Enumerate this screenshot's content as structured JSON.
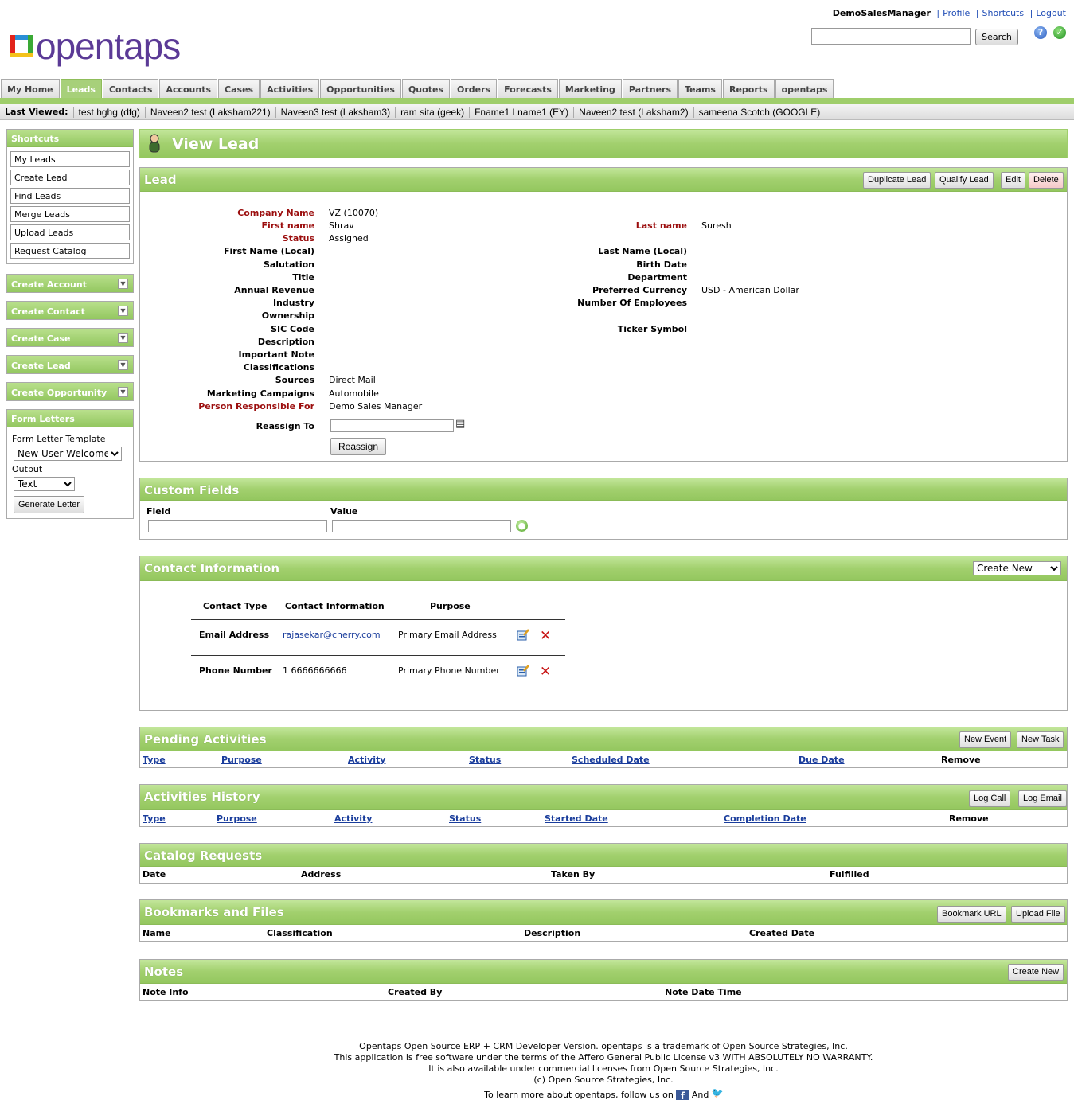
{
  "header": {
    "username": "DemoSalesManager",
    "links": [
      "Profile",
      "Shortcuts",
      "Logout"
    ],
    "logo_text": "opentaps",
    "search_button": "Search"
  },
  "tabs": [
    "My Home",
    "Leads",
    "Contacts",
    "Accounts",
    "Cases",
    "Activities",
    "Opportunities",
    "Quotes",
    "Orders",
    "Forecasts",
    "Marketing",
    "Partners",
    "Teams",
    "Reports",
    "opentaps"
  ],
  "active_tab": "Leads",
  "last_viewed": {
    "label": "Last Viewed:",
    "items": [
      "test hghg (dfg)",
      "Naveen2 test (Laksham221)",
      "Naveen3 test (Laksham3)",
      "ram sita (geek)",
      "Fname1 Lname1 (EY)",
      "Naveen2 test (Laksham2)",
      "sameena Scotch (GOOGLE)"
    ]
  },
  "sidebar": {
    "shortcuts_title": "Shortcuts",
    "shortcuts": [
      "My Leads",
      "Create Lead",
      "Find Leads",
      "Merge Leads",
      "Upload Leads",
      "Request Catalog"
    ],
    "create_sections": [
      "Create Account",
      "Create Contact",
      "Create Case",
      "Create Lead",
      "Create Opportunity"
    ],
    "form_letters": {
      "title": "Form Letters",
      "template_label": "Form Letter Template",
      "template_value": "New User Welcome",
      "output_label": "Output",
      "output_value": "Text",
      "generate_button": "Generate Letter"
    }
  },
  "page_title": "View Lead",
  "lead": {
    "title": "Lead",
    "buttons": [
      "Duplicate Lead",
      "Qualify Lead",
      "Edit",
      "Delete"
    ],
    "left_fields": [
      {
        "label": "Company Name",
        "value": "VZ (10070)",
        "required": true
      },
      {
        "label": "First name",
        "value": "Shrav",
        "required": true
      },
      {
        "label": "Status",
        "value": "Assigned",
        "required": true
      },
      {
        "label": "First Name (Local)",
        "value": "",
        "required": false
      },
      {
        "label": "Salutation",
        "value": "",
        "required": false
      },
      {
        "label": "Title",
        "value": "",
        "required": false
      },
      {
        "label": "Annual Revenue",
        "value": "",
        "required": false
      },
      {
        "label": "Industry",
        "value": "",
        "required": false
      },
      {
        "label": "Ownership",
        "value": "",
        "required": false
      },
      {
        "label": "SIC Code",
        "value": "",
        "required": false
      },
      {
        "label": "Description",
        "value": "",
        "required": false
      },
      {
        "label": "Important Note",
        "value": "",
        "required": false
      },
      {
        "label": "Classifications",
        "value": "",
        "required": false
      },
      {
        "label": "Sources",
        "value": "Direct Mail",
        "required": false
      },
      {
        "label": "Marketing Campaigns",
        "value": "Automobile",
        "required": false
      }
    ],
    "right_fields": [
      {
        "label": "Last name",
        "value": "Suresh",
        "required": true
      },
      {
        "label": "Last Name (Local)",
        "value": "",
        "required": false
      },
      {
        "label": "Birth Date",
        "value": "",
        "required": false
      },
      {
        "label": "Department",
        "value": "",
        "required": false
      },
      {
        "label": "Preferred Currency",
        "value": "USD - American Dollar",
        "required": false
      },
      {
        "label": "Number Of Employees",
        "value": "",
        "required": false
      },
      {
        "label": "Ticker Symbol",
        "value": "",
        "required": false
      }
    ],
    "person_responsible_label": "Person Responsible For",
    "person_responsible_value": "Demo Sales Manager",
    "reassign_label": "Reassign To",
    "reassign_button": "Reassign"
  },
  "custom_fields": {
    "title": "Custom Fields",
    "field_label": "Field",
    "value_label": "Value"
  },
  "contact_info": {
    "title": "Contact Information",
    "create_new": "Create New",
    "headers": [
      "Contact Type",
      "Contact Information",
      "Purpose"
    ],
    "rows": [
      {
        "type": "Email Address",
        "info": "rajasekar@cherry.com",
        "purpose": "Primary Email Address"
      },
      {
        "type": "Phone Number",
        "info": "1 6666666666",
        "purpose": "Primary Phone Number"
      }
    ]
  },
  "pending_activities": {
    "title": "Pending Activities",
    "buttons": [
      "New Event",
      "New Task"
    ],
    "columns": [
      "Type",
      "Purpose",
      "Activity",
      "Status",
      "Scheduled Date",
      "Due Date",
      "Remove"
    ]
  },
  "activities_history": {
    "title": "Activities History",
    "buttons": [
      "Log Call",
      "Log Email"
    ],
    "columns": [
      "Type",
      "Purpose",
      "Activity",
      "Status",
      "Started Date",
      "Completion Date",
      "Remove"
    ]
  },
  "catalog_requests": {
    "title": "Catalog Requests",
    "columns": [
      "Date",
      "Address",
      "Taken By",
      "Fulfilled"
    ]
  },
  "bookmarks": {
    "title": "Bookmarks and Files",
    "buttons": [
      "Bookmark URL",
      "Upload File"
    ],
    "columns": [
      "Name",
      "Classification",
      "Description",
      "Created Date"
    ]
  },
  "notes": {
    "title": "Notes",
    "button": "Create New",
    "columns": [
      "Note Info",
      "Created By",
      "Note Date Time"
    ]
  },
  "footer": {
    "lines": [
      "Opentaps Open Source ERP + CRM Developer Version. opentaps is a trademark of Open Source Strategies, Inc.",
      "This application is free software under the terms of the Affero General Public License v3 WITH ABSOLUTELY NO WARRANTY.",
      "It is also available under commercial licenses from Open Source Strategies, Inc.",
      "(c) Open Source Strategies, Inc."
    ],
    "follow_text": "To learn more about opentaps, follow us on",
    "and_text": "And"
  },
  "colors": {
    "green_header": "#9fce6b",
    "required_label": "#9b0d0d",
    "link": "#1a3d9c"
  }
}
